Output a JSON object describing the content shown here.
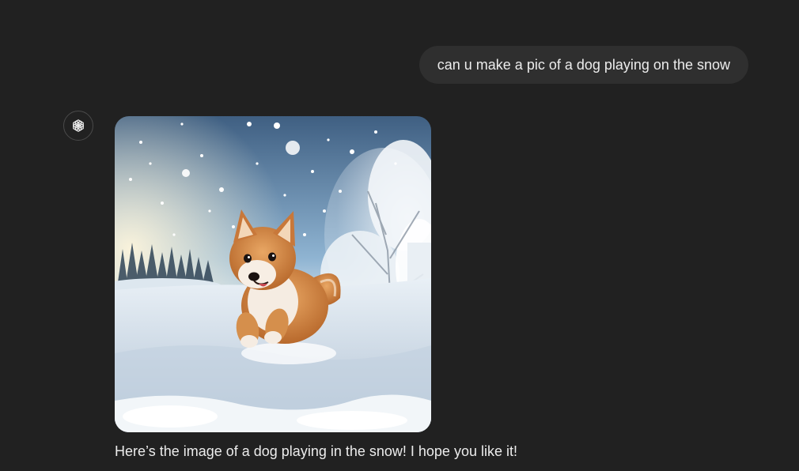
{
  "conversation": {
    "user_message": "can u make a pic of a dog playing on the snow",
    "assistant": {
      "avatar_icon": "openai-logo-icon",
      "image_subject": "dog-in-snow",
      "reply": "Here’s the image of a dog playing in the snow! I hope you like it!"
    }
  },
  "colors": {
    "background": "#212121",
    "user_bubble": "#2f2f2f",
    "text": "#ececec"
  }
}
